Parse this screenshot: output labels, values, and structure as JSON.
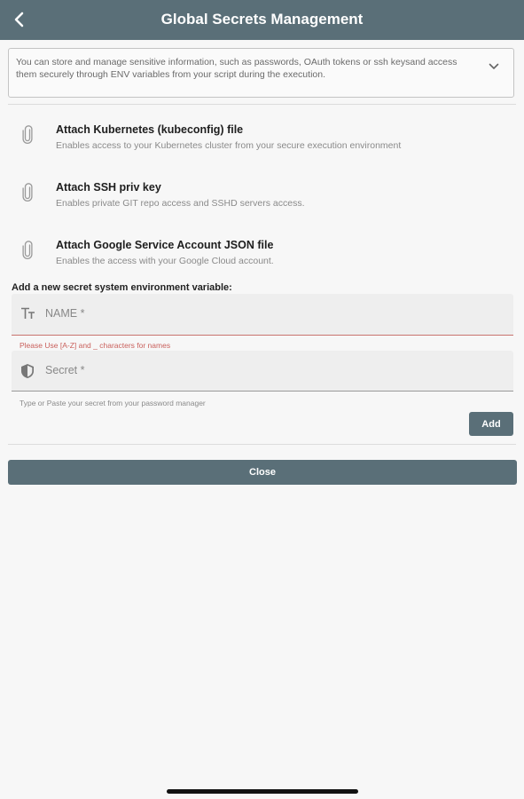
{
  "appbar": {
    "title": "Global Secrets Management",
    "back_icon": "chevron-left-icon"
  },
  "info": {
    "text": "You can store and manage sensitive information, such as passwords, OAuth tokens or ssh keysand access them securely through ENV variables from your script during the execution.",
    "expand_icon": "chevron-down-icon"
  },
  "attachments": [
    {
      "title": "Attach Kubernetes (kubeconfig) file",
      "subtitle": "Enables access to your Kubernetes cluster from your secure execution environment",
      "icon": "paperclip-icon"
    },
    {
      "title": "Attach SSH priv key",
      "subtitle": "Enables private GIT repo access and SSHD servers access.",
      "icon": "paperclip-icon"
    },
    {
      "title": "Attach Google Service Account JSON file",
      "subtitle": "Enables the access with your Google Cloud account.",
      "icon": "paperclip-icon"
    }
  ],
  "form": {
    "section_label": "Add a new secret system environment variable:",
    "name_placeholder": "NAME *",
    "name_error": "Please Use [A-Z] and _ characters for names",
    "secret_placeholder": "Secret *",
    "secret_helper": "Type or Paste your secret from your password manager",
    "add_label": "Add"
  },
  "close_label": "Close",
  "colors": {
    "primary": "#5a6f78",
    "error": "#c9605c"
  }
}
